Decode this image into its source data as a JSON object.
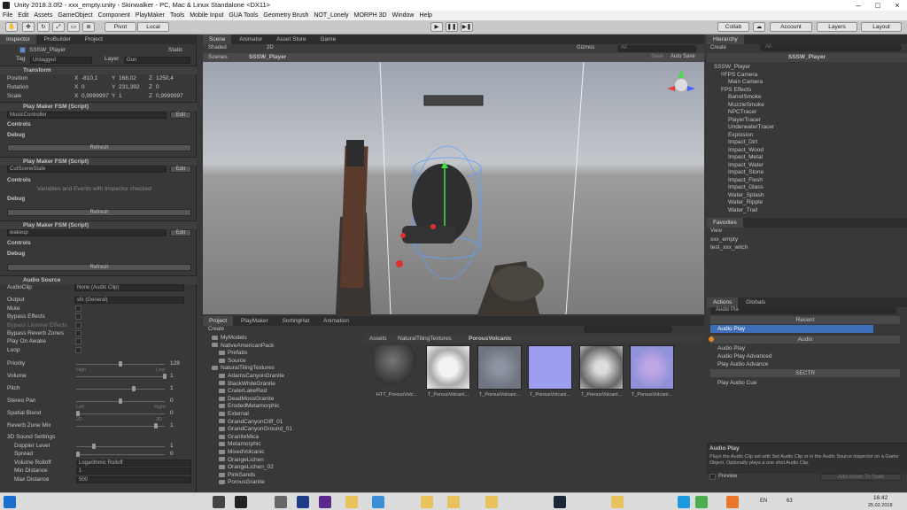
{
  "window": {
    "title": "Unity 2018.3.0f2 - xxx_empty.unity - Skinwalker - PC, Mac & Linux Standalone <DX11>"
  },
  "menu": [
    "File",
    "Edit",
    "Assets",
    "GameObject",
    "Component",
    "PlayMaker",
    "Tools",
    "Mobile Input",
    "GUA Tools",
    "Geometry Brush",
    "NOT_Lonely",
    "MORPH 3D",
    "Window",
    "Help"
  ],
  "toolbar": {
    "pivot": "Pivot",
    "local": "Local",
    "collab": "Collab",
    "account": "Account",
    "layers": "Layers",
    "layout": "Layout"
  },
  "inspector": {
    "tabs": [
      "Inspector",
      "ProBuilder",
      "Project"
    ],
    "object_name": "SSSW_Player",
    "static": "Static",
    "tag_label": "Tag",
    "tag": "Untagged",
    "layer_label": "Layer",
    "layer": "Gun",
    "transform": {
      "title": "Transform",
      "position": "Position",
      "rotation": "Rotation",
      "scale": "Scale",
      "pos": {
        "x": "-810,1",
        "y": "168,02",
        "z": "1250,4"
      },
      "rot": {
        "x": "0",
        "y": "231,392",
        "z": "0"
      },
      "scl": {
        "x": "0,9999997",
        "y": "1",
        "z": "0,9999997"
      }
    },
    "fsm_title": "Play Maker FSM (Script)",
    "fsm1": {
      "name": "MusicController"
    },
    "fsm2": {
      "name": "CutSceneState",
      "note": "Variables and Events with Inspector checked"
    },
    "fsm3": {
      "name": "wakeup"
    },
    "controls": "Controls",
    "debug": "Debug",
    "refresh": "Refresh",
    "edit": "Edit",
    "audio": {
      "title": "Audio Source",
      "clip_label": "AudioClip",
      "clip": "None (Audio Clip)",
      "output_label": "Output",
      "output": "sfx (General)",
      "mute": "Mute",
      "bypass_effects": "Bypass Effects",
      "bypass_listener": "Bypass Listener Effects",
      "bypass_reverb": "Bypass Reverb Zones",
      "play_on_awake": "Play On Awake",
      "loop": "Loop",
      "priority": "Priority",
      "priority_val": "128",
      "high": "High",
      "low": "Low",
      "volume": "Volume",
      "volume_val": "1",
      "pitch": "Pitch",
      "pitch_val": "1",
      "stereo_pan": "Stereo Pan",
      "stereo_val": "0",
      "left": "Left",
      "right": "Right",
      "spatial_blend": "Spatial Blend",
      "spatial_val": "0",
      "twod": "2D",
      "threed": "3D",
      "reverb_mix": "Reverb Zone Mix",
      "reverb_val": "1",
      "sound3d": "3D Sound Settings",
      "doppler": "Doppler Level",
      "doppler_val": "1",
      "spread": "Spread",
      "spread_val": "0",
      "rolloff": "Volume Rolloff",
      "rolloff_val": "Logarithmic Rolloff",
      "min_dist": "Min Distance",
      "min_val": "1",
      "max_dist": "Max Distance",
      "max_val": "500"
    }
  },
  "scene": {
    "tabs": [
      "Scene",
      "Animator",
      "Asset Store",
      "Game"
    ],
    "shaded": "Shaded",
    "twod": "2D",
    "gizmos": "Gizmos",
    "search": "All",
    "breadcrumb_root": "Scenes",
    "breadcrumb_obj": "SSSW_Player",
    "save": "Save",
    "autosave": "Auto Save"
  },
  "hierarchy": {
    "tab": "Hierarchy",
    "create": "Create",
    "search": "All",
    "scene": "SSSW_Player",
    "items": [
      "SSSW_Player",
      "!!FPS Camera",
      "Main Camera",
      "FPS Effects",
      "BarrelSmoke",
      "MuzzleSmoke",
      "NPCTracer",
      "PlayerTracer",
      "UnderwaterTracer",
      "Explosion",
      "Impact_Dirt",
      "Impact_Wood",
      "Impact_Metal",
      "Impact_Water",
      "Impact_Stone",
      "Impact_Flesh",
      "Impact_Glass",
      "Water_Splash",
      "Water_Ripple",
      "Water_Trail"
    ]
  },
  "favorites": {
    "tab": "Favorites",
    "view": "View",
    "items": [
      "xxx_empty",
      "test_xxx_witch"
    ]
  },
  "actions": {
    "tabs": [
      "Actions",
      "Globals"
    ],
    "search": "Audio Pla",
    "recent": "Recent",
    "selected": "Audio Play",
    "audio_header": "Audio",
    "audio_items": [
      "Audio Play",
      "Audio Play Advanced",
      "Play Audio Advance"
    ],
    "sectr": "SECTR",
    "sectr_items": [
      "Play Audio Cue"
    ],
    "desc_title": "Audio Play",
    "desc": "Plays the Audio Clip set with Set Audio Clip or in the Audio Source inspector on a Game Object. Optionally plays a one shot Audio Clip.",
    "preview": "Preview",
    "add_action": "Add Action To State"
  },
  "project": {
    "tabs": [
      "Project",
      "PlayMaker",
      "SortingHat",
      "Animation"
    ],
    "create": "Create",
    "folders": [
      "MyModels",
      "NativeAmericanPack",
      "Prefabs",
      "Source",
      "NaturalTilingTextures",
      "AdamsCanyonGranite",
      "BlackWhiteGranite",
      "CraterLakeRed",
      "DeadMossGranite",
      "ErodedMetamorphic",
      "External",
      "GrandCanyonCliff_01",
      "GrandCanyonGround_01",
      "GraniteMica",
      "Metamorphic",
      "MixedVolcanic",
      "OrangeLichen",
      "OrangeLichen_02",
      "PinkSands",
      "PorousGranite"
    ],
    "breadcrumb": [
      "Assets",
      "NaturalTilingTextures",
      "PorousVolcanic"
    ],
    "assets": [
      "HTT_PorousVolc...",
      "T_PorousVolcani...",
      "T_PorousVolcani...",
      "T_PorousVolcani...",
      "T_PorousVolcani...",
      "T_PorousVolcani..."
    ]
  },
  "taskbar": {
    "time": "16:42",
    "date": "25.02.2018",
    "lang": "EN",
    "num": "63"
  }
}
